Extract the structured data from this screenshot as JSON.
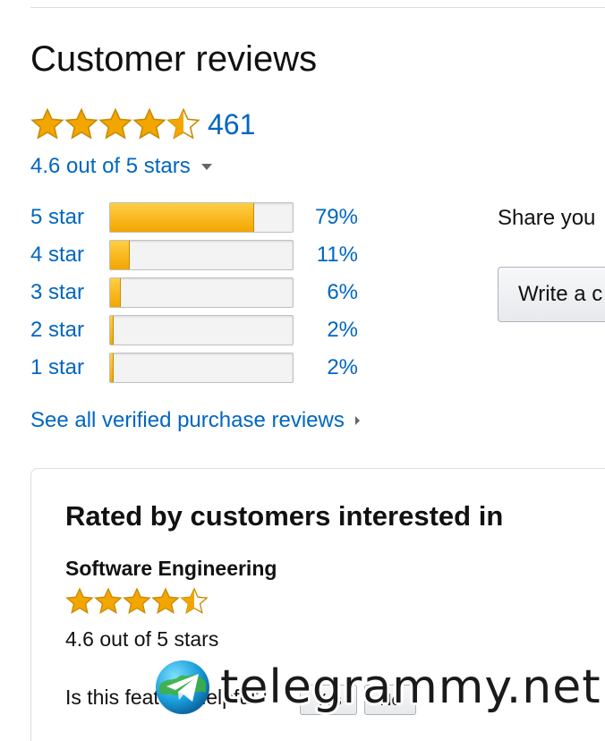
{
  "reviews": {
    "title": "Customer reviews",
    "rating_count": "461",
    "stars_value": 4.5,
    "average_text": "4.6 out of 5 stars",
    "histogram": [
      {
        "label": "5 star",
        "percent": 79,
        "percent_text": "79%"
      },
      {
        "label": "4 star",
        "percent": 11,
        "percent_text": "11%"
      },
      {
        "label": "3 star",
        "percent": 6,
        "percent_text": "6%"
      },
      {
        "label": "2 star",
        "percent": 2,
        "percent_text": "2%"
      },
      {
        "label": "1 star",
        "percent": 2,
        "percent_text": "2%"
      }
    ],
    "see_all_link": "See all verified purchase reviews"
  },
  "share": {
    "text": "Share you",
    "write_button": "Write a c"
  },
  "rated_box": {
    "title": "Rated by customers interested in",
    "topic": "Software Engineering",
    "stars_value": 4.5,
    "average_text": "4.6 out of 5 stars",
    "helpful_question": "Is this feature helpful?",
    "yes_label": "Yes",
    "no_label": "No"
  },
  "watermark": {
    "text": "telegrammy.net"
  },
  "colors": {
    "link": "#0066c0",
    "star_fill": "#f3a600",
    "bar_fill": "#ffb800"
  }
}
